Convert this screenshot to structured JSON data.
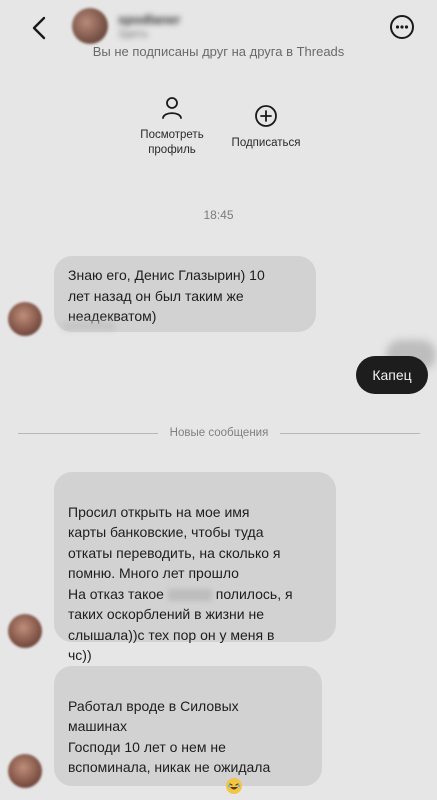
{
  "header": {
    "username": "spodlaner",
    "status": "Здесь",
    "notice": "Вы не подписаны друг на друга в Threads"
  },
  "actions": {
    "view_profile": "Посмотреть\nпрофиль",
    "follow": "Подписаться"
  },
  "timestamp": "18:45",
  "messages": {
    "incoming_1": "Знаю его, Денис Глазырин) 10\nлет назад он был таким же\nнеадекватом)",
    "outgoing_1": "Капец",
    "divider": "Новые сообщения",
    "incoming_2_part1": "Просил открыть на мое имя\nкарты банковские, чтобы туда\nоткаты переводить, на сколько я\nпомню. Много лет прошло\nНа отказ такое ",
    "incoming_2_part2": " полилось, я\nтаких оскорблений в жизни не\nслышала))с тех пор он у меня в\nчс))",
    "incoming_3": "Работал вроде в Силовых\nмашинах\nГосподи 10 лет о нем не\nвспоминала, никак не ожидала\nего увидеть вновь здесь"
  },
  "icons": [
    "back-icon",
    "more-options-icon",
    "person-icon",
    "plus-circle-icon",
    "laughing-emoji-icon"
  ],
  "colors": {
    "background": "#e6e6e6",
    "incoming_bubble": "#d2d2d2",
    "outgoing_bubble": "#1d1d1d"
  }
}
